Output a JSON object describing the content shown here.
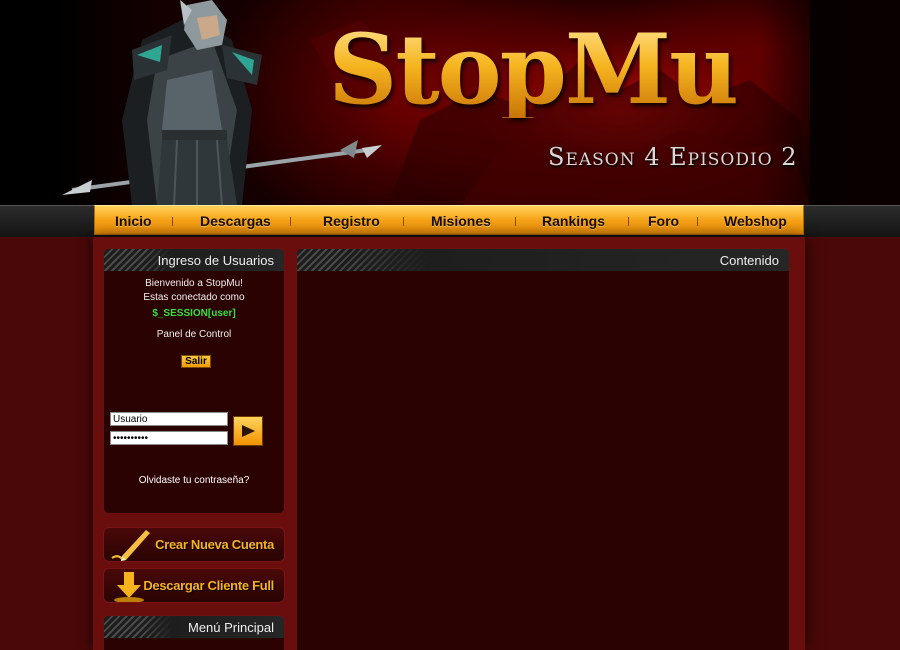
{
  "header": {
    "logo": "StopMu",
    "tagline": "Season 4 Episodio 2"
  },
  "nav": {
    "items": [
      "Inicio",
      "Descargas",
      "Registro",
      "Misiones",
      "Rankings",
      "Foro",
      "Webshop"
    ]
  },
  "login_panel": {
    "title": "Ingreso de Usuarios",
    "welcome": "Bienvenido a StopMu!",
    "connected_as": "Estas conectado como",
    "session_user": "$_SESSION[user]",
    "control_panel": "Panel de Control",
    "logout_label": "Salir",
    "username_value": "Usuario",
    "password_value": "••••••••••",
    "forgot_password": "Olvidaste tu contraseña?"
  },
  "buttons": {
    "create_account": "Crear Nueva Cuenta",
    "download_client": "Descargar Cliente Full"
  },
  "main_menu": {
    "title": "Menú Principal"
  },
  "content": {
    "title": "Contenido"
  },
  "colors": {
    "accent_orange": "#f8a418",
    "logo_gold": "#f2b01c",
    "session_green": "#35e03a",
    "panel_bg": "#2b0202",
    "page_red": "#6a0d0d"
  },
  "icons": {
    "submit": "arrow-right-icon",
    "create": "pen-icon",
    "download": "download-arrow-icon"
  }
}
